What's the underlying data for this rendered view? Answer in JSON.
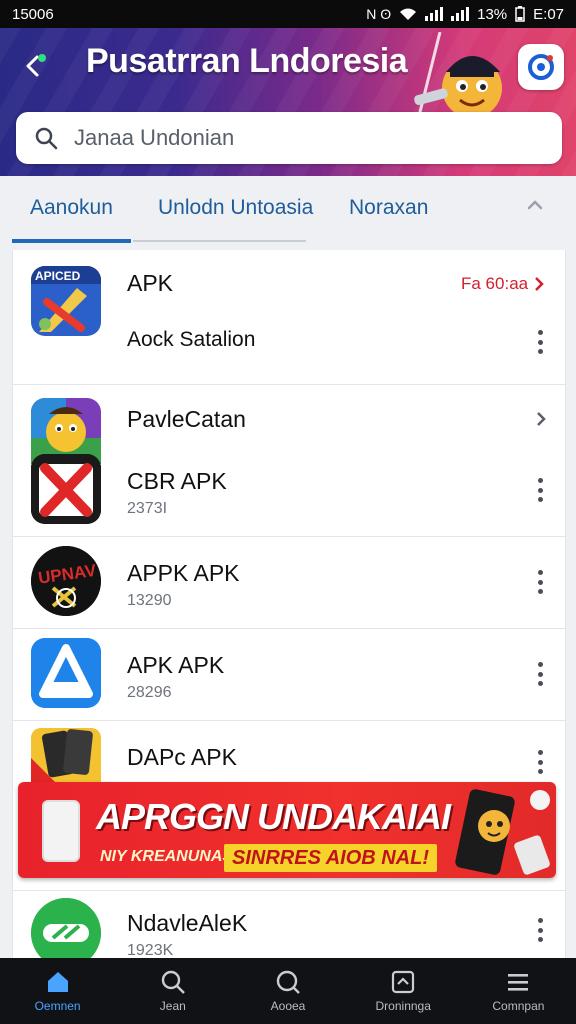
{
  "status_bar": {
    "time": "15006",
    "battery": "13%",
    "clock": "E:07",
    "left_icons": "N ʘ"
  },
  "header": {
    "title": "Pusatrran Lndoresia",
    "search": {
      "value": "",
      "placeholder": "Janaa Undonian"
    }
  },
  "tabs": [
    {
      "label": "Aanokun",
      "active": true
    },
    {
      "label": "Unlodn Untoasia",
      "active": false
    },
    {
      "label": "Noraxan",
      "active": false
    }
  ],
  "list": {
    "items": [
      {
        "title": "APK",
        "link_label": "Fa 60:aa",
        "subtitle": "Aock Satalion",
        "icon": "apk-brush-icon"
      },
      {
        "title": "PavleCatan",
        "subtitle": "",
        "icon": "emoji-mascot-icon"
      },
      {
        "title": "CBR APK",
        "subtitle": "2373I",
        "icon": "red-x-icon"
      },
      {
        "title": "APPK APK",
        "subtitle": "13290",
        "icon": "black-circle-badge-icon"
      },
      {
        "title": "APK APK",
        "subtitle": "28296",
        "icon": "app-store-icon"
      },
      {
        "title": "DAPc APK",
        "subtitle": "",
        "icon": "phone-stack-icon"
      },
      {
        "title": "NdavleAleK",
        "subtitle": "1923K",
        "icon": "green-circle-icon"
      }
    ]
  },
  "promo": {
    "title": "APRGGN UNDAKAIAI",
    "subtitle": "NIY KREANUNAS",
    "cta": "SINRRES AIOB NAL!"
  },
  "bottom_nav": [
    {
      "label": "Oemnen",
      "icon": "home-icon",
      "active": true
    },
    {
      "label": "Jean",
      "icon": "search-icon",
      "active": false
    },
    {
      "label": "Aooea",
      "icon": "search-icon",
      "active": false
    },
    {
      "label": "Droninnga",
      "icon": "download-icon",
      "active": false
    },
    {
      "label": "Comnpan",
      "icon": "menu-icon",
      "active": false
    }
  ],
  "colors": {
    "accent": "#1c6ab8",
    "link_red": "#d2202e",
    "promo_red": "#e8222b"
  }
}
